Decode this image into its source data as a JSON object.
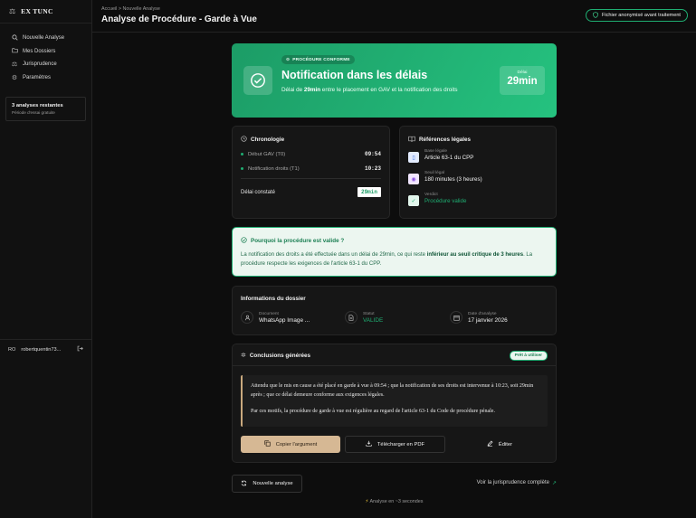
{
  "app": {
    "brand": "EX TUNC"
  },
  "sidebar": {
    "items": [
      {
        "icon": "search-icon",
        "label": "Nouvelle Analyse"
      },
      {
        "icon": "folder-icon",
        "label": "Mes Dossiers"
      },
      {
        "icon": "scale-icon",
        "label": "Jurisprudence"
      },
      {
        "icon": "gear-icon",
        "label": "Paramètres"
      }
    ],
    "trial": {
      "title": "3 analyses restantes",
      "subtitle": "Période d'essai gratuite"
    },
    "user": {
      "initials": "RO",
      "name": "robertquentin73..."
    }
  },
  "header": {
    "breadcrumb": "Accueil > Nouvelle Analyse",
    "title": "Analyse de Procédure - Garde à Vue",
    "anon_badge": "Fichier anonymisé avant traitement"
  },
  "hero": {
    "badge": "PROCÉDURE CONFORME",
    "title": "Notification dans les délais",
    "desc_pre": "Délai de ",
    "desc_bold": "29min",
    "desc_post": " entre le placement en GAV et la notification des droits",
    "delay_label": "Délai",
    "delay_value": "29min"
  },
  "chronologie": {
    "title": "Chronologie",
    "rows": [
      {
        "label": "Début GAV (T0)",
        "time": "09:54"
      },
      {
        "label": "Notification droits (T1)",
        "time": "10:23"
      }
    ],
    "delay_label": "Délai constaté",
    "delay_value": "29min"
  },
  "references": {
    "title": "Références légales",
    "items": [
      {
        "label": "Base légale",
        "value": "Article 63-1 du CPP"
      },
      {
        "label": "Seuil légal",
        "value": "180 minutes (3 heures)"
      },
      {
        "label": "Verdict",
        "value": "Procédure valide"
      }
    ]
  },
  "why": {
    "title": "Pourquoi la procédure est valide ?",
    "text_pre": "La notification des droits a été effectuée dans un délai de 29min, ce qui reste ",
    "text_bold": "inférieur au seuil critique de 3 heures",
    "text_post": ". La procédure respecte les exigences de l'article 63-1 du CPP."
  },
  "dossier": {
    "title": "Informations du dossier",
    "document_label": "Document",
    "document_value": "WhatsApp Image ...",
    "status_label": "Statut",
    "status_value": "VALIDE",
    "date_label": "Date d'analyse",
    "date_value": "17 janvier 2026"
  },
  "conclusions": {
    "title": "Conclusions générées",
    "ready": "Prêt à utiliser",
    "p1": "Attendu que le mis en cause a été placé en garde à vue à 09:54 ; que la notification de ses droits est intervenue à 10:23, soit 29min après ; que ce délai demeure conforme aux exigences légales.",
    "p2": "Par ces motifs, la procédure de garde à vue est régulière au regard de l'article 63-1 du Code de procédure pénale.",
    "copy": "Copier l'argument",
    "pdf": "Télécharger en PDF",
    "edit": "Éditer"
  },
  "footer": {
    "new_analysis": "Nouvelle analyse",
    "jurisprudence": "Voir la jurisprudence complète",
    "timing": "Analyse en ~3 secondes"
  },
  "colors": {
    "accent": "#1fae72",
    "copy_button": "#d6b894"
  }
}
